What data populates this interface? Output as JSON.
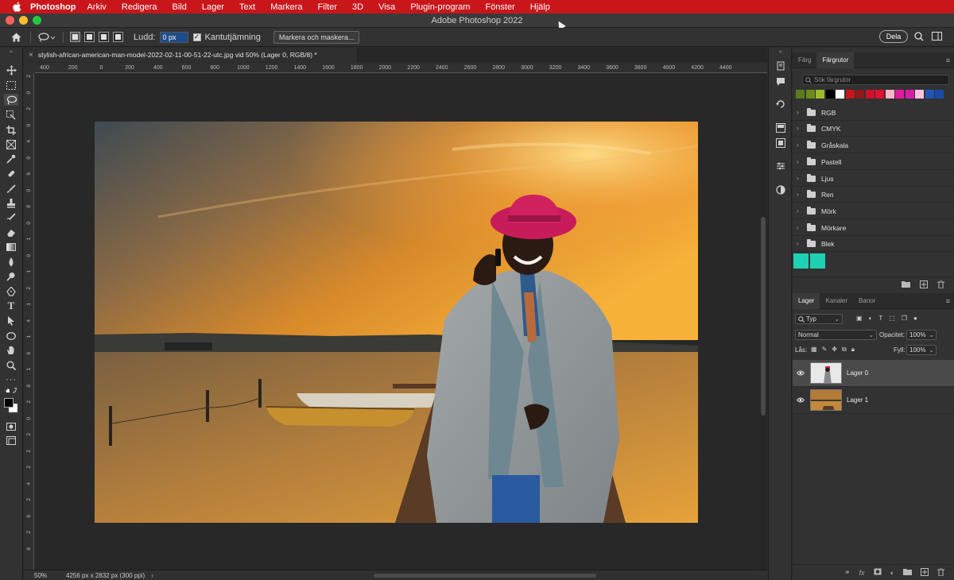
{
  "menubar": {
    "app": "Photoshop",
    "items": [
      "Arkiv",
      "Redigera",
      "Bild",
      "Lager",
      "Text",
      "Markera",
      "Filter",
      "3D",
      "Visa",
      "Plugin-program",
      "Fönster",
      "Hjälp"
    ]
  },
  "window": {
    "title": "Adobe Photoshop 2022"
  },
  "options": {
    "feather_label": "Ludd:",
    "feather_value": "0 px",
    "antialias_label": "Kantutjämning",
    "select_mask_label": "Markera och maskera...",
    "share_label": "Dela"
  },
  "document": {
    "tab_title": "stylish-african-american-man-model-2022-02-11-00-51-22-utc.jpg vid 50% (Lager 0, RGB/8) *",
    "zoom": "50%",
    "dimensions": "4256 px x 2832 px (300 ppi)"
  },
  "ruler": {
    "h_labels": [
      "400",
      "200",
      "0",
      "200",
      "400",
      "600",
      "800",
      "1000",
      "1200",
      "1400",
      "1600",
      "1800",
      "2000",
      "2200",
      "2400",
      "2600",
      "2800",
      "3000",
      "3200",
      "3400",
      "3600",
      "3800",
      "4000",
      "4200",
      "4400"
    ],
    "v_labels": [
      "2",
      "0",
      "2",
      "0",
      "4",
      "0",
      "6",
      "0",
      "8",
      "0",
      "1",
      "0",
      "1",
      "2",
      "1",
      "4",
      "1",
      "6",
      "1",
      "8",
      "2",
      "0",
      "2",
      "2",
      "2",
      "4",
      "2",
      "6",
      "2",
      "8"
    ]
  },
  "swatches_panel": {
    "tabs": [
      "Färg",
      "Färgrutor"
    ],
    "active_tab": "Färgrutor",
    "search_placeholder": "Sök färgrutor",
    "recent_colors": [
      "#5a7a1e",
      "#6c8c1a",
      "#9dbb2b",
      "#000000",
      "#ffffff",
      "#c8161b",
      "#8b1a1a",
      "#d0102a",
      "#e0102f",
      "#ffb6c8",
      "#e01aa0",
      "#d21fa8",
      "#ffc2e0",
      "#1f55b5",
      "#1a4aa8"
    ],
    "folders": [
      "RGB",
      "CMYK",
      "Gråskala",
      "Pastell",
      "Ljus",
      "Ren",
      "Mörk",
      "Mörkare",
      "Blek"
    ],
    "loose_colors": [
      "#1ed1b4",
      "#1ed1b4"
    ]
  },
  "layers_panel": {
    "tabs": [
      "Lager",
      "Kanaler",
      "Banor"
    ],
    "active_tab": "Lager",
    "filter_kind": "Typ",
    "blend_mode": "Normal",
    "opacity_label": "Opacitet:",
    "opacity_value": "100%",
    "lock_label": "Lås:",
    "fill_label": "Fyll:",
    "fill_value": "100%",
    "layers": [
      {
        "name": "Lager 0",
        "selected": true
      },
      {
        "name": "Lager 1",
        "selected": false
      }
    ]
  }
}
